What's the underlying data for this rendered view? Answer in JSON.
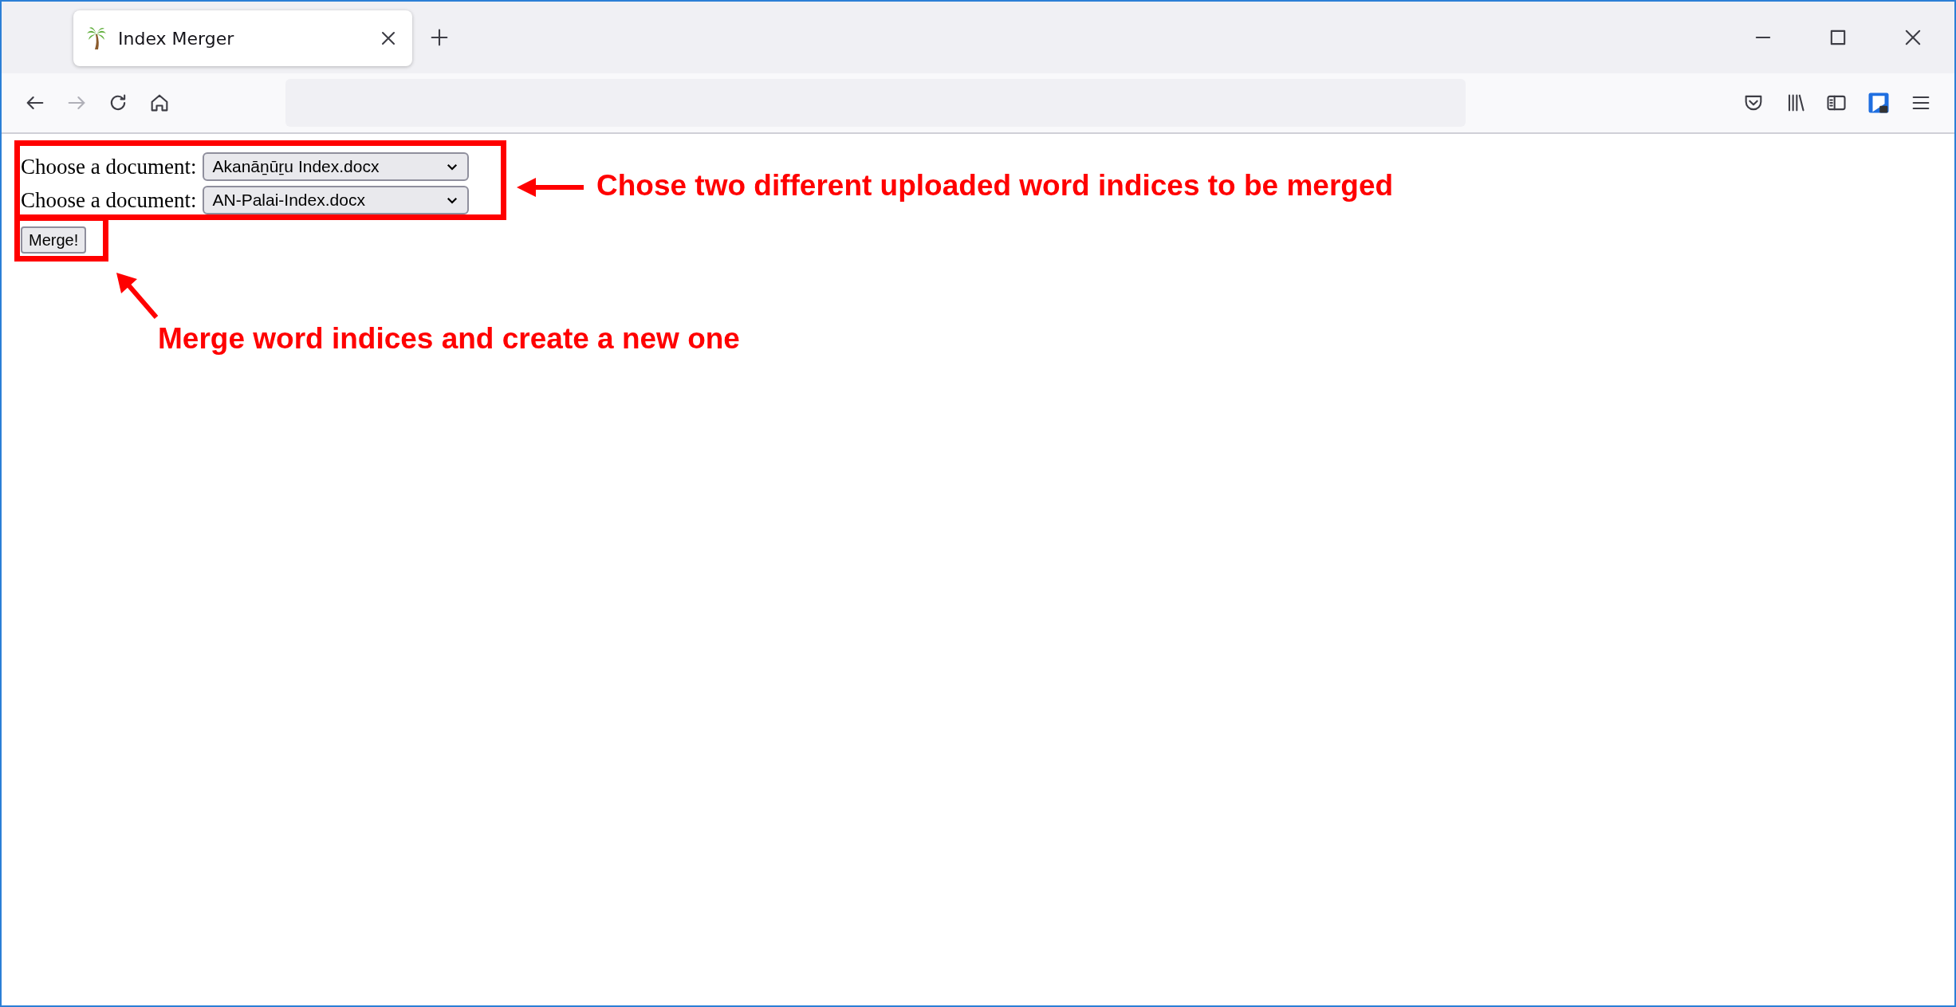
{
  "browser": {
    "tab": {
      "title": "Index Merger",
      "selected": true
    }
  },
  "form": {
    "rows": [
      {
        "label": "Choose a document:",
        "value": "Akanāṉūṟu Index.docx"
      },
      {
        "label": "Choose a document:",
        "value": "AN-Palai-Index.docx"
      }
    ],
    "button": "Merge!"
  },
  "annotations": [
    {
      "kind": "arrow-right",
      "text": "Chose two different uploaded word indices to be merged"
    },
    {
      "kind": "arrow-below",
      "text": "Merge word indices and create a new one"
    }
  ]
}
